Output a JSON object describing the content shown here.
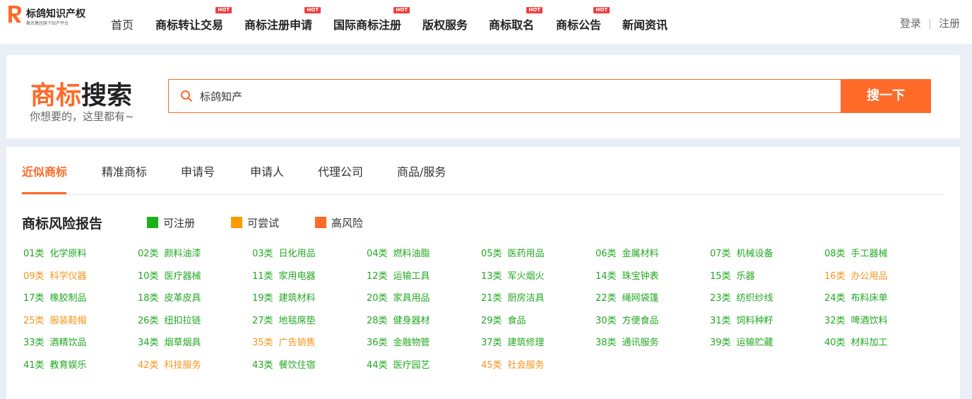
{
  "header": {
    "logo_title": "标鸽知识产权",
    "logo_sub": "聚名集团旗下知产平台",
    "nav": [
      {
        "label": "首页",
        "hot": false
      },
      {
        "label": "商标转让交易",
        "hot": true
      },
      {
        "label": "商标注册申请",
        "hot": true
      },
      {
        "label": "国际商标注册",
        "hot": true
      },
      {
        "label": "版权服务",
        "hot": false
      },
      {
        "label": "商标取名",
        "hot": true
      },
      {
        "label": "商标公告",
        "hot": true
      },
      {
        "label": "新闻资讯",
        "hot": false
      }
    ],
    "hot_label": "HOT",
    "login": "登录",
    "separator": "|",
    "register": "注册"
  },
  "search": {
    "title_part1": "商标",
    "title_part2": "搜索",
    "subtitle": "你想要的，这里都有~",
    "value": "标鸽知产",
    "button": "搜一下"
  },
  "tabs": [
    {
      "label": "近似商标",
      "active": true
    },
    {
      "label": "精准商标",
      "active": false
    },
    {
      "label": "申请号",
      "active": false
    },
    {
      "label": "申请人",
      "active": false
    },
    {
      "label": "代理公司",
      "active": false
    },
    {
      "label": "商品/服务",
      "active": false
    }
  ],
  "risk": {
    "title": "商标风险报告",
    "legend": [
      {
        "label": "可注册",
        "color": "#1ab21a"
      },
      {
        "label": "可尝试",
        "color": "#ff9900"
      },
      {
        "label": "高风险",
        "color": "#ff6a28"
      }
    ]
  },
  "colors": {
    "green": "#22a822",
    "orange": "#f5941d",
    "accent": "#ff6a28"
  },
  "categories": [
    {
      "code": "01类",
      "name": "化学原料",
      "status": "green"
    },
    {
      "code": "02类",
      "name": "颜料油漆",
      "status": "green"
    },
    {
      "code": "03类",
      "name": "日化用品",
      "status": "green"
    },
    {
      "code": "04类",
      "name": "燃料油脂",
      "status": "green"
    },
    {
      "code": "05类",
      "name": "医药用品",
      "status": "green"
    },
    {
      "code": "06类",
      "name": "金属材料",
      "status": "green"
    },
    {
      "code": "07类",
      "name": "机械设备",
      "status": "green"
    },
    {
      "code": "08类",
      "name": "手工器械",
      "status": "green"
    },
    {
      "code": "09类",
      "name": "科学仪器",
      "status": "orange"
    },
    {
      "code": "10类",
      "name": "医疗器械",
      "status": "green"
    },
    {
      "code": "11类",
      "name": "家用电器",
      "status": "green"
    },
    {
      "code": "12类",
      "name": "运输工具",
      "status": "green"
    },
    {
      "code": "13类",
      "name": "军火烟火",
      "status": "green"
    },
    {
      "code": "14类",
      "name": "珠宝钟表",
      "status": "green"
    },
    {
      "code": "15类",
      "name": "乐器",
      "status": "green"
    },
    {
      "code": "16类",
      "name": "办公用品",
      "status": "orange"
    },
    {
      "code": "17类",
      "name": "橡胶制品",
      "status": "green"
    },
    {
      "code": "18类",
      "name": "皮革皮具",
      "status": "green"
    },
    {
      "code": "19类",
      "name": "建筑材料",
      "status": "green"
    },
    {
      "code": "20类",
      "name": "家具用品",
      "status": "green"
    },
    {
      "code": "21类",
      "name": "厨房洁具",
      "status": "green"
    },
    {
      "code": "22类",
      "name": "绳网袋篷",
      "status": "green"
    },
    {
      "code": "23类",
      "name": "纺织纱线",
      "status": "green"
    },
    {
      "code": "24类",
      "name": "布料床单",
      "status": "green"
    },
    {
      "code": "25类",
      "name": "服装鞋帽",
      "status": "orange"
    },
    {
      "code": "26类",
      "name": "纽扣拉链",
      "status": "green"
    },
    {
      "code": "27类",
      "name": "地毯席垫",
      "status": "green"
    },
    {
      "code": "28类",
      "name": "健身器材",
      "status": "green"
    },
    {
      "code": "29类",
      "name": "食品",
      "status": "green"
    },
    {
      "code": "30类",
      "name": "方便食品",
      "status": "green"
    },
    {
      "code": "31类",
      "name": "饲料种籽",
      "status": "green"
    },
    {
      "code": "32类",
      "name": "啤酒饮料",
      "status": "green"
    },
    {
      "code": "33类",
      "name": "酒精饮品",
      "status": "green"
    },
    {
      "code": "34类",
      "name": "烟草烟具",
      "status": "green"
    },
    {
      "code": "35类",
      "name": "广告销售",
      "status": "orange"
    },
    {
      "code": "36类",
      "name": "金融物管",
      "status": "green"
    },
    {
      "code": "37类",
      "name": "建筑修理",
      "status": "green"
    },
    {
      "code": "38类",
      "name": "通讯服务",
      "status": "green"
    },
    {
      "code": "39类",
      "name": "运输贮藏",
      "status": "green"
    },
    {
      "code": "40类",
      "name": "材料加工",
      "status": "green"
    },
    {
      "code": "41类",
      "name": "教育娱乐",
      "status": "green"
    },
    {
      "code": "42类",
      "name": "科技服务",
      "status": "orange"
    },
    {
      "code": "43类",
      "name": "餐饮住宿",
      "status": "green"
    },
    {
      "code": "44类",
      "name": "医疗园艺",
      "status": "green"
    },
    {
      "code": "45类",
      "name": "社会服务",
      "status": "orange"
    }
  ]
}
